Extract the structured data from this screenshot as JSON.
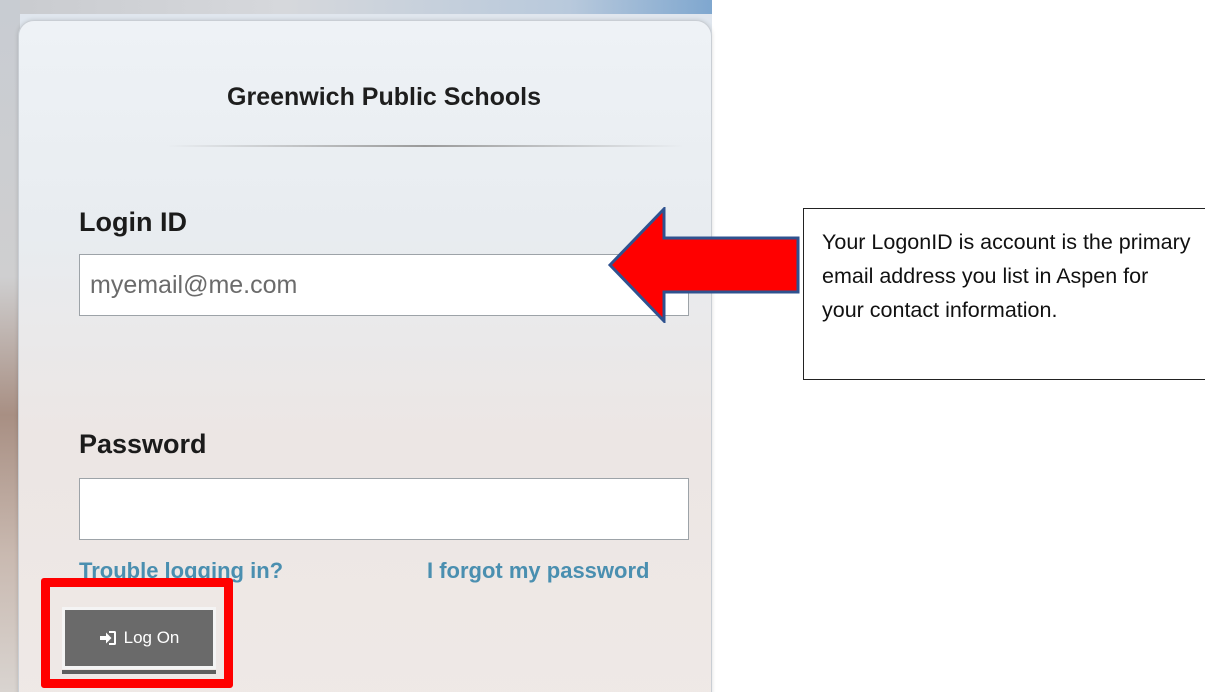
{
  "login_card": {
    "title": "Greenwich Public Schools",
    "login_id_label": "Login ID",
    "login_id_value": "myemail@me.com",
    "password_label": "Password",
    "password_value": "",
    "trouble_link": "Trouble logging in?",
    "forgot_link": "I forgot my password",
    "logon_button_label": "Log On",
    "logon_icon": "sign-in-icon"
  },
  "annotation": {
    "callout_text": "Your LogonID is account is the primary email address you list in Aspen for your contact information.",
    "arrow_color": "#ff0000",
    "arrow_outline_color": "#2f528f",
    "highlight_color": "#ff0000"
  },
  "colors": {
    "link": "#4a8fb0",
    "button_bg": "#6a6a6a",
    "title_text": "#1e1e1e"
  }
}
